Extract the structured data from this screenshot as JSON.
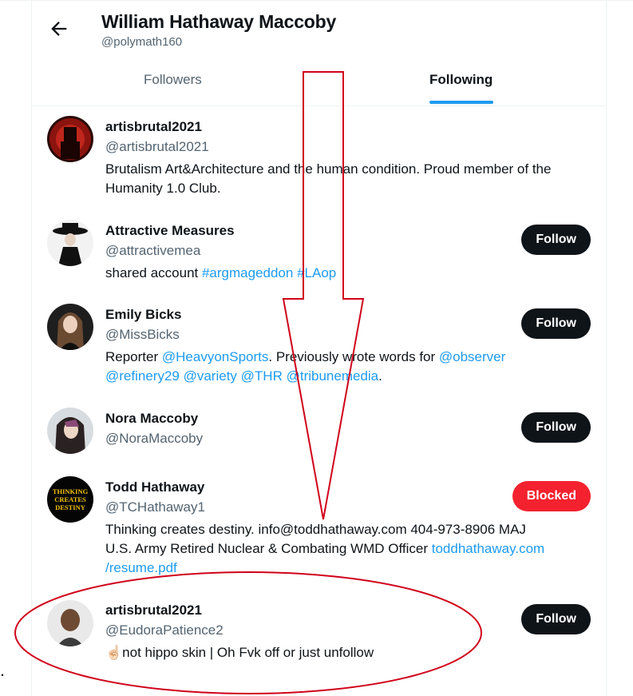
{
  "header": {
    "title": "William Hathaway Maccoby",
    "handle": "@polymath160",
    "back_icon": "arrow-left-icon"
  },
  "tabs": [
    {
      "label": "Followers",
      "active": false
    },
    {
      "label": "Following",
      "active": true
    }
  ],
  "left_edge_text": ".",
  "accounts": [
    {
      "name": "artisbrutal2021",
      "handle": "@artisbrutal2021",
      "bio_line1": "Brutalism Art&Architecture and the human condition. Proud member of the",
      "bio_line2": "Humanity 1.0 Club.",
      "button": ""
    },
    {
      "name": "Attractive Measures",
      "handle": "@attractivemea",
      "bio_text": "shared account ",
      "bio_links": [
        "#argmageddon",
        "#LAop"
      ],
      "button": "Follow"
    },
    {
      "name": "Emily Bicks",
      "handle": "@MissBicks",
      "bio_text1": "Reporter ",
      "bio_link1": "@HeavyonSports",
      "bio_text2": ". Previously wrote words for ",
      "bio_link2": "@observer",
      "bio_link3": "@refinery29",
      "bio_link4": "@variety",
      "bio_link5": "@THR",
      "bio_link6": "@tribunemedia",
      "bio_text3": ".",
      "button": "Follow"
    },
    {
      "name": "Nora Maccoby",
      "handle": "@NoraMaccoby",
      "button": "Follow"
    },
    {
      "name": "Todd Hathaway",
      "handle": "@TCHathaway1",
      "avatar_text": [
        "THINKING",
        "CREATES",
        "DESTINY"
      ],
      "bio_line1": "Thinking creates destiny. info@toddhathaway.com 404-973-8906 MAJ",
      "bio_line2_text": "U.S. Army Retired Nuclear & Combating WMD Officer ",
      "bio_line2_link": "toddhathaway.com",
      "bio_line3_link": "/resume.pdf",
      "button": "Blocked"
    },
    {
      "name": "artisbrutal2021",
      "handle": "@EudoraPatience2",
      "bio": "☝🏻not hippo skin | Oh Fvk off or just unfollow",
      "button": "Follow"
    }
  ],
  "colors": {
    "link": "#1d9bf0",
    "follow_button": "#0f1419",
    "blocked_button": "#f4212e",
    "annotation": "#d0021b",
    "secondary_text": "#536471"
  }
}
